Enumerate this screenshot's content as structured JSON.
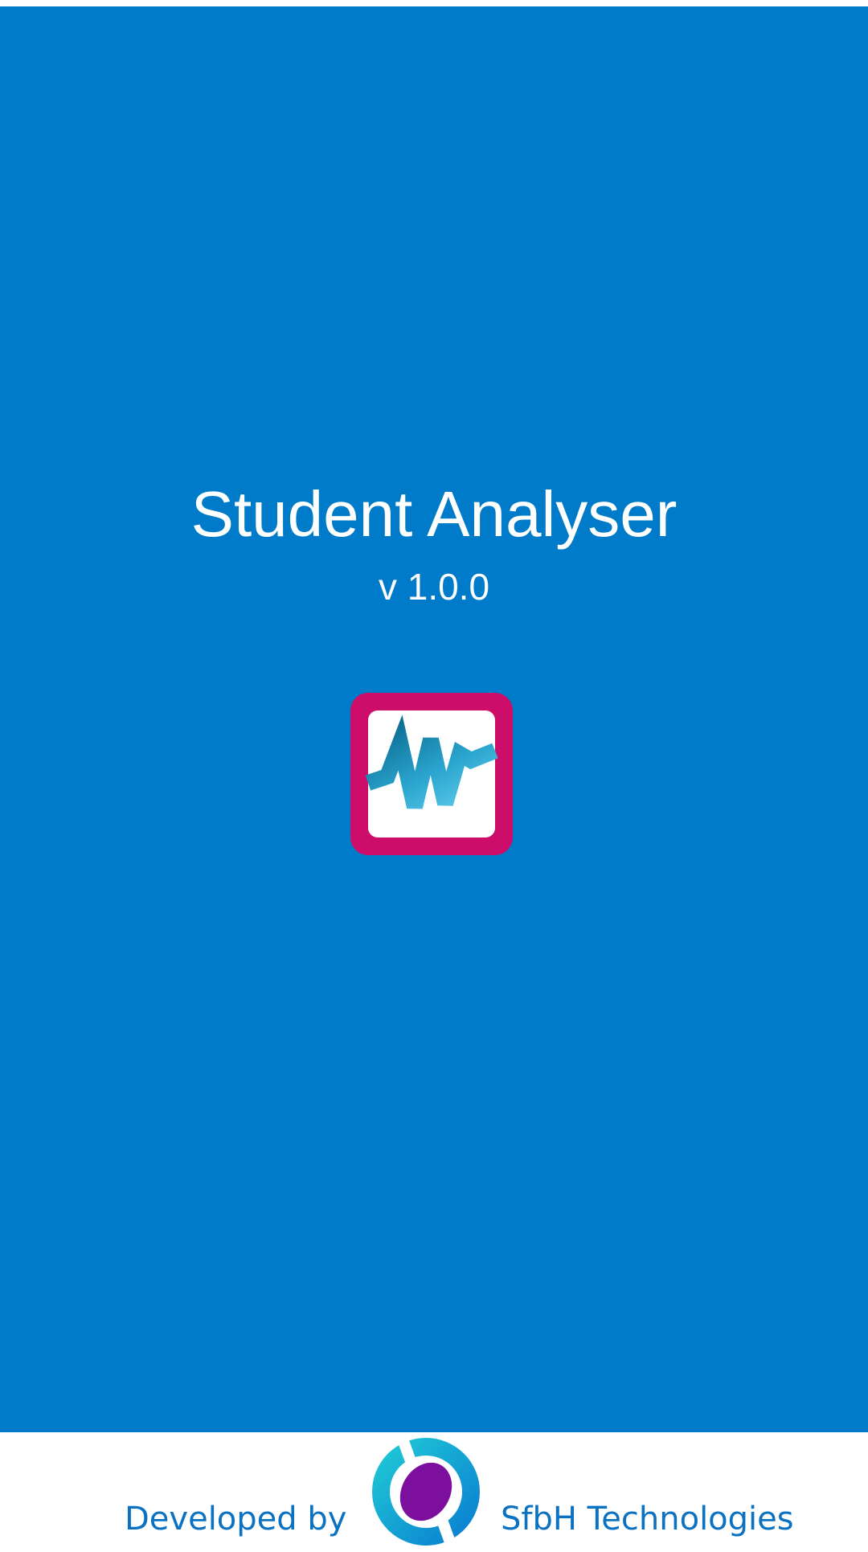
{
  "splash": {
    "title": "Student Analyser",
    "version": "v 1.0.0",
    "background_color": "#007bc9",
    "app_icon": "waveform-chart-icon",
    "app_icon_frame_color": "#cc0e6a"
  },
  "footer": {
    "developed_by_label": "Developed by",
    "company_name": "SfbH Technologies",
    "company_logo": "sfbh-ring-logo-icon",
    "text_color": "#0b72c2"
  }
}
